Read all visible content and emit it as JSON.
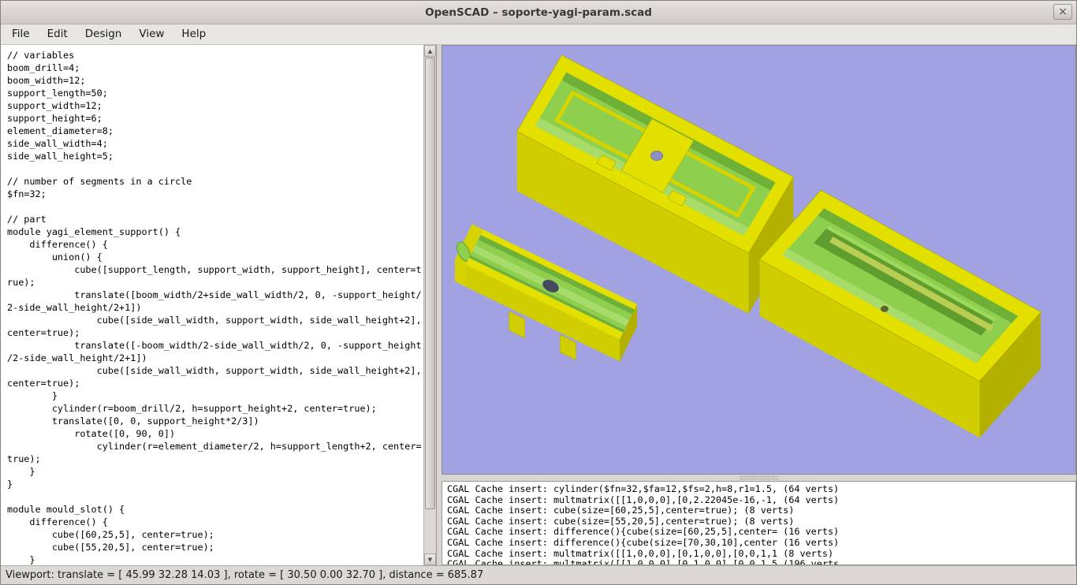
{
  "window": {
    "title": "OpenSCAD – soporte-yagi-param.scad",
    "close_label": "×"
  },
  "menu": {
    "items": [
      "File",
      "Edit",
      "Design",
      "View",
      "Help"
    ]
  },
  "editor": {
    "code_lines": [
      "// variables",
      "boom_drill=4;",
      "boom_width=12;",
      "support_length=50;",
      "support_width=12;",
      "support_height=6;",
      "element_diameter=8;",
      "side_wall_width=4;",
      "side_wall_height=5;",
      "",
      "// number of segments in a circle",
      "$fn=32;",
      "",
      "// part",
      "module yagi_element_support() {",
      "    difference() {",
      "        union() {",
      "            cube([support_length, support_width, support_height], center=t",
      "rue);",
      "            translate([boom_width/2+side_wall_width/2, 0, -support_height/",
      "2-side_wall_height/2+1])",
      "                cube([side_wall_width, support_width, side_wall_height+2],",
      "center=true);",
      "            translate([-boom_width/2-side_wall_width/2, 0, -support_height",
      "/2-side_wall_height/2+1])",
      "                cube([side_wall_width, support_width, side_wall_height+2],",
      "center=true);",
      "        }",
      "        cylinder(r=boom_drill/2, h=support_height+2, center=true);",
      "        translate([0, 0, support_height*2/3])",
      "            rotate([0, 90, 0])",
      "                cylinder(r=element_diameter/2, h=support_length+2, center=",
      "true);",
      "    }",
      "}",
      "",
      "module mould_slot() {",
      "    difference() {",
      "        cube([60,25,5], center=true);",
      "        cube([55,20,5], center=true);",
      "    }"
    ]
  },
  "console": {
    "lines": [
      "CGAL Cache insert: cylinder($fn=32,$fa=12,$fs=2,h=8,r1=1.5, (64 verts)",
      "CGAL Cache insert: multmatrix([[1,0,0,0],[0,2.22045e-16,-1, (64 verts)",
      "CGAL Cache insert: cube(size=[60,25,5],center=true); (8 verts)",
      "CGAL Cache insert: cube(size=[55,20,5],center=true); (8 verts)",
      "CGAL Cache insert: difference(){cube(size=[60,25,5],center= (16 verts)",
      "CGAL Cache insert: difference(){cube(size=[70,30,10],center (16 verts)",
      "CGAL Cache insert: multmatrix([[1,0,0,0],[0,1,0,0],[0,0,1,1 (8 verts)",
      "CGAL Cache insert: multmatrix([[1,0,0,0],[0,1,0,0],[0,0,1,5 (196 verts"
    ]
  },
  "status_bar": {
    "text": "Viewport: translate = [ 45.99 32.28 14.03 ], rotate = [ 30.50 0.00 32.70 ], distance = 685.87"
  },
  "colors": {
    "viewport-bg": "#a2a2e2",
    "part-top": "#e3e000",
    "part-front": "#d0cd00",
    "part-side": "#b3b000",
    "part-end": "#d6d300",
    "recess-green": "#8ed04e",
    "green-dark": "#6fb037",
    "green-light": "#a8dc6a",
    "slot-green": "#5f9e2e",
    "ridge-green": "#b9ce52",
    "ledge-yellow": "#d6d300",
    "hole-lavender": "#8e8ec4",
    "hole-dark": "#454a60",
    "hole-small": "#5c6430"
  }
}
